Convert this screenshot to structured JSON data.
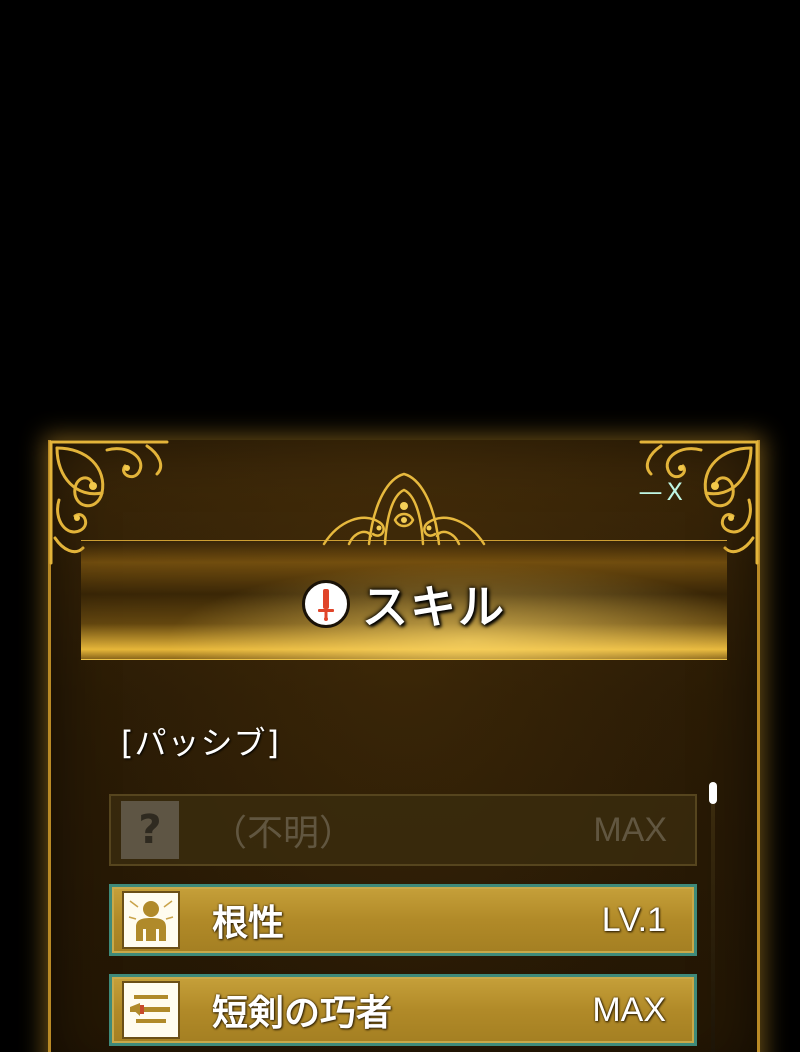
{
  "window": {
    "minimize_label": "—",
    "close_label": "X"
  },
  "header": {
    "title": "スキル",
    "icon": "sword-circle-icon"
  },
  "section": {
    "label": "[パッシブ]"
  },
  "skills": [
    {
      "name": "（不明）",
      "level": "MAX",
      "icon": "question-icon",
      "state": "locked"
    },
    {
      "name": "根性",
      "level": "LV.1",
      "icon": "person-icon",
      "state": "active"
    },
    {
      "name": "短剣の巧者",
      "level": "MAX",
      "icon": "dagger-icon",
      "state": "active"
    }
  ],
  "colors": {
    "frame_gold": "#b98a26",
    "row_gold": "#b18a28",
    "row_border": "#3e8a7a",
    "control_text": "#bff6e4"
  }
}
